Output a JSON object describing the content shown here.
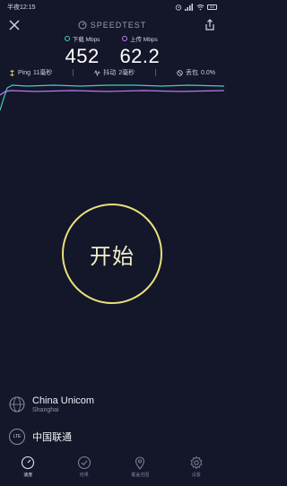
{
  "status": {
    "time": "半夜12:15",
    "battery": "69"
  },
  "header": {
    "brand": "SPEEDTEST"
  },
  "metrics": {
    "download": {
      "label": "下载 Mbps",
      "value": "452",
      "color": "#3fd1c1"
    },
    "upload": {
      "label": "上传 Mbps",
      "value": "62.2",
      "color": "#b77df0"
    }
  },
  "stats": {
    "ping": {
      "label": "Ping",
      "value": "11毫秒"
    },
    "jitter": {
      "label": "抖动",
      "value": "2毫秒"
    },
    "loss": {
      "label": "丢包",
      "value": "0.0%"
    }
  },
  "start_button": {
    "label": "开始"
  },
  "isp": {
    "name": "China Unicom",
    "location": "Shanghai"
  },
  "network": {
    "badge": "LTE",
    "name": "中国联通"
  },
  "nav": [
    {
      "label": "速度",
      "icon": "speedometer-icon"
    },
    {
      "label": "结果",
      "icon": "checkmark-circle-icon"
    },
    {
      "label": "覆盖范围",
      "icon": "map-pin-icon"
    },
    {
      "label": "设置",
      "icon": "gear-icon"
    }
  ],
  "colors": {
    "background": "#14162a",
    "accent_yellow": "#e8e07a",
    "download": "#3fd1c1",
    "upload": "#b77df0"
  }
}
